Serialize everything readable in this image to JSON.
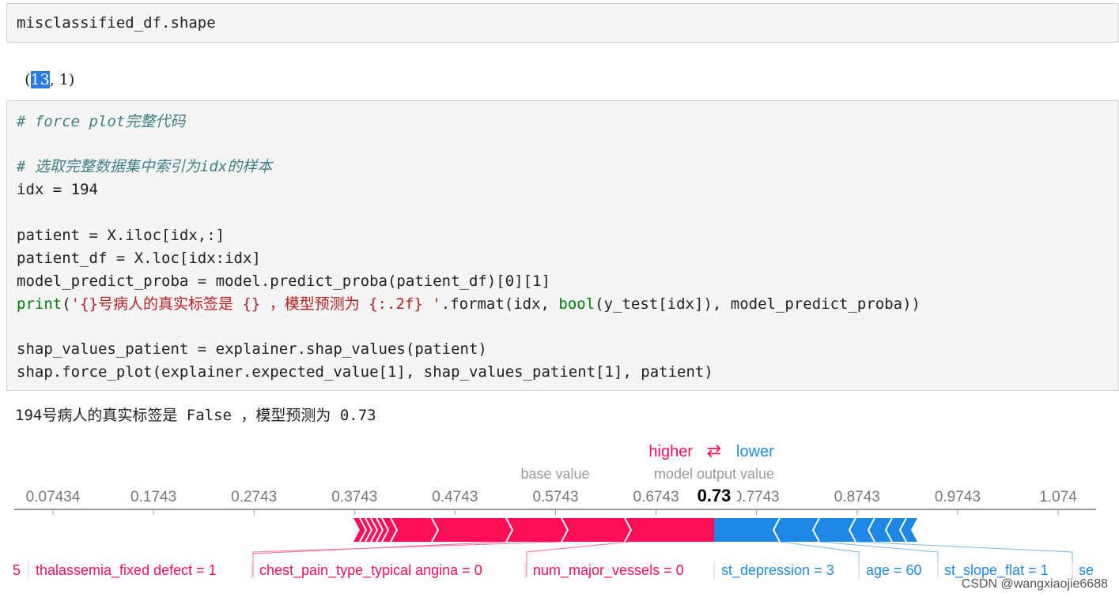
{
  "cell1": {
    "code": "misclassified_df.shape"
  },
  "output1": {
    "open": "(",
    "selected": "13",
    "rest": ", 1)"
  },
  "cell2": {
    "comment1": "# force plot完整代码",
    "comment2": "# 选取完整数据集中索引为idx的样本",
    "line_idx": "idx = 194",
    "line_patient": "patient = X.iloc[idx,:]",
    "line_patient_df": "patient_df = X.loc[idx:idx]",
    "line_proba": "model_predict_proba = model.predict_proba(patient_df)[0][1]",
    "print_kw": "print",
    "print_open": "(",
    "print_string": "'{}号病人的真实标签是 {} ，模型预测为 {:.2f} '",
    "print_mid": ".format(idx, ",
    "bool_kw": "bool",
    "print_end": "(y_test[idx]), model_predict_proba))",
    "line_shap": "shap_values_patient = explainer.shap_values(patient)",
    "line_force": "shap.force_plot(explainer.expected_value[1], shap_values_patient[1], patient)"
  },
  "output2": {
    "text": "194号病人的真实标签是 False ，模型预测为 0.73"
  },
  "force_plot": {
    "legend": {
      "higher": "higher",
      "arrows": "⇄",
      "lower": "lower"
    },
    "base_value_label": "base value",
    "output_value_label": "model output value",
    "output_value": "0.73",
    "ticks": [
      "0.07434",
      "0.1743",
      "0.2743",
      "0.3743",
      "0.4743",
      "0.5743",
      "0.6743",
      "0.7743",
      "0.8743",
      "0.9743",
      "1.074"
    ],
    "features_left": [
      {
        "label": "5"
      },
      {
        "label": "thalassemia_fixed defect = 1"
      },
      {
        "label": "chest_pain_type_typical angina = 0"
      },
      {
        "label": "num_major_vessels = 0"
      }
    ],
    "features_right": [
      {
        "label": "st_depression = 3"
      },
      {
        "label": "age = 60"
      },
      {
        "label": "st_slope_flat = 1"
      },
      {
        "label": "se"
      }
    ],
    "colors": {
      "positive": "#ff0d57",
      "negative": "#1e88e5"
    }
  },
  "watermark": "CSDN @wangxiaojie6688"
}
